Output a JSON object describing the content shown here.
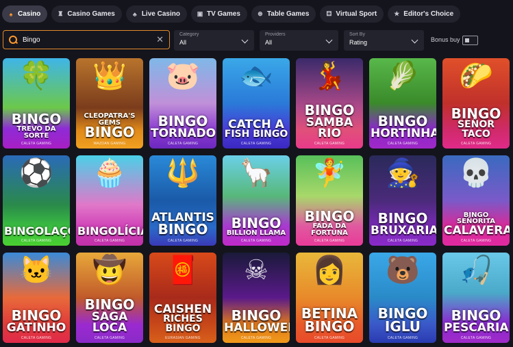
{
  "tabs": [
    {
      "label": "Casino",
      "icon": "casino-icon",
      "glyph": "♠",
      "active": true
    },
    {
      "label": "Casino Games",
      "icon": "casino-games-icon",
      "glyph": "♜",
      "active": false
    },
    {
      "label": "Live Casino",
      "icon": "live-casino-icon",
      "glyph": "♣",
      "active": false
    },
    {
      "label": "TV Games",
      "icon": "tv-icon",
      "glyph": "▣",
      "active": false
    },
    {
      "label": "Table Games",
      "icon": "table-games-icon",
      "glyph": "⊛",
      "active": false
    },
    {
      "label": "Virtual Sport",
      "icon": "gamepad-icon",
      "glyph": "⚃",
      "active": false
    },
    {
      "label": "Editor's Choice",
      "icon": "star-icon",
      "glyph": "★",
      "active": false
    }
  ],
  "search": {
    "value": "Bingo"
  },
  "filters": [
    {
      "label": "Category",
      "value": "All"
    },
    {
      "label": "Providers",
      "value": "All"
    },
    {
      "label": "Sort By",
      "value": "Rating"
    }
  ],
  "bonus_buy": {
    "label": "Bonus buy",
    "checked": false
  },
  "colors": {
    "accent": "#ff9a2e",
    "background": "#14141c"
  },
  "games": [
    {
      "line1": "Bingo",
      "line2": "Trevo da Sorte",
      "provider": "CALETA GAMING",
      "art": "🍀",
      "bg": "linear-gradient(180deg,#3fb5e8 0%,#6cc84a 55%,#8e2bd6 78%,#a81fc4 100%)"
    },
    {
      "line1": "Cleopatra's Gems",
      "line2": "Bingo",
      "provider": "WAZDAN GAMING",
      "art": "👑",
      "bg": "linear-gradient(180deg,#b8742c 0%,#7a3c1c 55%,#e08a1a 80%,#f0a020 100%)"
    },
    {
      "line1": "Bingo",
      "line2": "Tornado",
      "provider": "CALETA GAMING",
      "art": "🐷",
      "bg": "linear-gradient(180deg,#7fb8e8 0%,#c090d8 50%,#8a3ad0 80%,#6c28c0 100%)"
    },
    {
      "line1": "Catch a",
      "line2": "Fish Bingo",
      "provider": "CALETA GAMING",
      "art": "🐟",
      "bg": "linear-gradient(180deg,#3aa8e8 0%,#2a7ad8 50%,#4a3ad8 80%,#3a28c0 100%)"
    },
    {
      "line1": "Bingo",
      "line2": "Samba Rio",
      "provider": "CALETA GAMING",
      "art": "💃",
      "bg": "linear-gradient(180deg,#3a2a6a 0%,#b04a8a 55%,#e0507a 80%,#e83a8a 100%)"
    },
    {
      "line1": "Bingo",
      "line2": "Hortinha",
      "provider": "CALETA GAMING",
      "art": "🥬",
      "bg": "linear-gradient(180deg,#58b84a 0%,#3a8a2a 50%,#8a2ac8 78%,#a028c8 100%)"
    },
    {
      "line1": "Bingo",
      "line2": "Señor Taco",
      "provider": "CALETA GAMING",
      "art": "🌮",
      "bg": "linear-gradient(180deg,#e0502a 0%,#c0302a 50%,#d02a6a 80%,#e02a8a 100%)"
    },
    {
      "line1": "Bingolaço",
      "line2": "",
      "provider": "CALETA GAMING",
      "art": "⚽",
      "bg": "linear-gradient(180deg,#2a6ab8 0%,#2a8a4a 55%,#3ac040 80%,#4ad030 100%)"
    },
    {
      "line1": "Bingolícia",
      "line2": "",
      "provider": "CALETA GAMING",
      "art": "🧁",
      "bg": "linear-gradient(180deg,#4ad0e8 0%,#e078c8 55%,#d040b8 80%,#c030a8 100%)"
    },
    {
      "line1": "Atlantis",
      "line2": "Bingo",
      "provider": "CALETA GAMING",
      "art": "🔱",
      "bg": "linear-gradient(180deg,#2a8ad8 0%,#1a5aa8 50%,#2a6ac8 80%,#3a3ab8 100%)"
    },
    {
      "line1": "Bingo",
      "line2": "Billion Llama",
      "provider": "CALETA GAMING",
      "art": "🦙",
      "bg": "linear-gradient(180deg,#6ad0e8 0%,#58b87a 45%,#a83ad0 78%,#c02ac8 100%)"
    },
    {
      "line1": "Bingo",
      "line2": "Fada da Fortuna",
      "provider": "CALETA GAMING",
      "art": "🧚",
      "bg": "linear-gradient(180deg,#58c05a 0%,#a8d86a 45%,#e05aa0 78%,#e83a98 100%)"
    },
    {
      "line1": "Bingo",
      "line2": "Bruxaria",
      "provider": "CALETA GAMING",
      "art": "🧙",
      "bg": "linear-gradient(180deg,#2a2a5a 0%,#4a2a7a 50%,#7a2ab8 80%,#8a2ac8 100%)"
    },
    {
      "line1": "Bingo Señorita",
      "line2": "Calavera",
      "provider": "CALETA GAMING",
      "art": "💀",
      "bg": "linear-gradient(180deg,#3a6ac0 0%,#7a5ac8 50%,#d82a9a 78%,#e02aa0 100%)"
    },
    {
      "line1": "Bingo",
      "line2": "Gatinho",
      "provider": "CALETA GAMING",
      "art": "🐱",
      "bg": "linear-gradient(180deg,#3a8ad8 0%,#e86a3a 50%,#e03a3a 80%,#e02a4a 100%)"
    },
    {
      "line1": "Bingo",
      "line2": "Saga Loca",
      "provider": "CALETA GAMING",
      "art": "🤠",
      "bg": "linear-gradient(180deg,#e8a83a 0%,#c05a2a 50%,#9a2ad0 80%,#8a2ac8 100%)"
    },
    {
      "line1": "Caishen",
      "line2": "Riches Bingo",
      "provider": "EURASIAN GAMING",
      "art": "🧧",
      "bg": "linear-gradient(180deg,#d84a1a 0%,#a82a1a 50%,#c8481a 80%,#d8601a 100%)"
    },
    {
      "line1": "Bingo",
      "line2": "Halloween",
      "provider": "CALETA GAMING",
      "art": "☠",
      "bg": "linear-gradient(180deg,#1a1a3a 0%,#5a1a8a 50%,#e07a1a 80%,#f09a1a 100%)"
    },
    {
      "line1": "Betina",
      "line2": "Bingo",
      "provider": "CALETA GAMING",
      "art": "👩",
      "bg": "linear-gradient(180deg,#e8b83a 0%,#e88a2a 50%,#e85a2a 80%,#e84a2a 100%)"
    },
    {
      "line1": "Bingo",
      "line2": "Iglu",
      "provider": "CALETA GAMING",
      "art": "🐻",
      "bg": "linear-gradient(180deg,#3aa8e8 0%,#2a8ac8 50%,#3a58c8 80%,#2a3ab0 100%)"
    },
    {
      "line1": "Bingo",
      "line2": "Pescaria",
      "provider": "CALETA GAMING",
      "art": "🎣",
      "bg": "linear-gradient(180deg,#6ac8e8 0%,#4aa8c8 45%,#8a2ad0 78%,#a02ac8 100%)"
    }
  ]
}
